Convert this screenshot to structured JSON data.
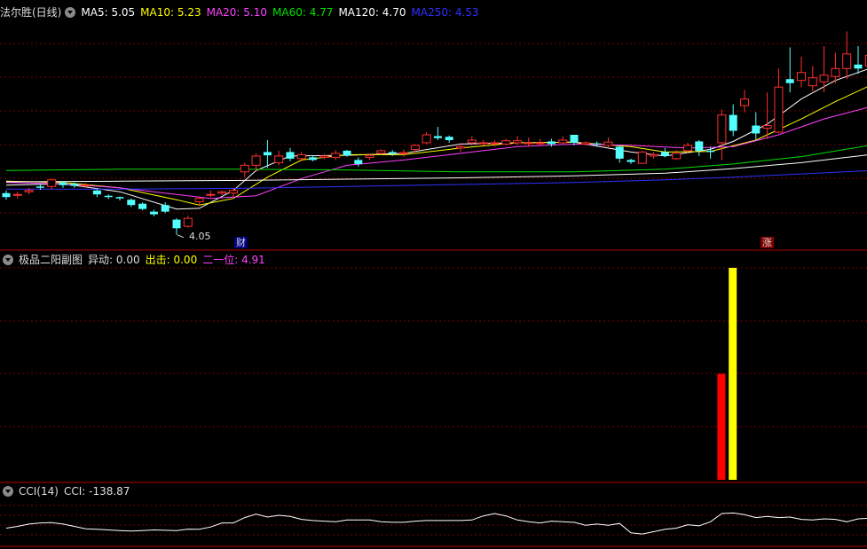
{
  "colors": {
    "ma5": "#ffffff",
    "ma10": "#ffff00",
    "ma20": "#ff40ff",
    "ma60": "#00e000",
    "ma120": "#ffffff",
    "ma250": "#3030ff",
    "up": "#ff3030",
    "down": "#54ffff",
    "grid": "#7a0000",
    "signal_red": "#ff0000",
    "signal_yellow": "#ffff00"
  },
  "main_panel": {
    "title": "法尔胜(日线)",
    "ma5": {
      "label": "MA5:",
      "value": "5.05"
    },
    "ma10": {
      "label": "MA10:",
      "value": "5.23"
    },
    "ma20": {
      "label": "MA20:",
      "value": "5.10"
    },
    "ma60": {
      "label": "MA60:",
      "value": "4.77"
    },
    "ma120": {
      "label": "MA120:",
      "value": "4.70"
    },
    "ma250": {
      "label": "MA250:",
      "value": "4.53"
    },
    "low_label": "4.05",
    "event_tag_1": "财",
    "event_tag_2": "涨"
  },
  "sub_panel": {
    "title": "极品二阳副图",
    "yidong": {
      "label": "异动:",
      "value": "0.00"
    },
    "chuji": {
      "label": "出击:",
      "value": "0.00"
    },
    "eryiwei": {
      "label": "二一位:",
      "value": "4.91"
    }
  },
  "cci_panel": {
    "title": "CCI(14)",
    "cci": {
      "label": "CCI:",
      "value": "-138.87"
    }
  },
  "chart_data": [
    {
      "type": "candlestick",
      "title": "法尔胜(日线)",
      "ylim": [
        3.9,
        7.3
      ],
      "candles": [
        [
          4.68,
          4.62,
          4.72,
          4.58
        ],
        [
          4.65,
          4.66,
          4.7,
          4.6
        ],
        [
          4.7,
          4.72,
          4.76,
          4.66
        ],
        [
          4.78,
          4.76,
          4.82,
          4.73
        ],
        [
          4.78,
          4.88,
          4.9,
          4.73
        ],
        [
          4.84,
          4.8,
          4.86,
          4.76
        ],
        [
          4.82,
          4.79,
          4.84,
          4.76
        ],
        [
          4.8,
          4.8,
          4.83,
          4.77
        ],
        [
          4.72,
          4.66,
          4.74,
          4.62
        ],
        [
          4.64,
          4.62,
          4.66,
          4.59
        ],
        [
          4.62,
          4.6,
          4.63,
          4.57
        ],
        [
          4.58,
          4.5,
          4.6,
          4.47
        ],
        [
          4.52,
          4.44,
          4.54,
          4.42
        ],
        [
          4.4,
          4.36,
          4.43,
          4.33
        ],
        [
          4.5,
          4.4,
          4.54,
          4.38
        ],
        [
          4.28,
          4.15,
          4.3,
          4.05
        ],
        [
          4.18,
          4.3,
          4.34,
          4.16
        ],
        [
          4.55,
          4.6,
          4.62,
          4.5
        ],
        [
          4.66,
          4.66,
          4.72,
          4.62
        ],
        [
          4.68,
          4.7,
          4.72,
          4.65
        ],
        [
          4.68,
          4.72,
          4.76,
          4.6
        ],
        [
          5.0,
          5.1,
          5.14,
          4.92
        ],
        [
          5.1,
          5.24,
          5.28,
          5.0
        ],
        [
          5.3,
          5.25,
          5.48,
          5.06
        ],
        [
          5.14,
          5.24,
          5.32,
          5.1
        ],
        [
          5.3,
          5.2,
          5.36,
          5.16
        ],
        [
          5.2,
          5.26,
          5.3,
          5.16
        ],
        [
          5.22,
          5.18,
          5.25,
          5.16
        ],
        [
          5.22,
          5.24,
          5.27,
          5.19
        ],
        [
          5.22,
          5.28,
          5.33,
          5.18
        ],
        [
          5.32,
          5.25,
          5.33,
          5.23
        ],
        [
          5.18,
          5.12,
          5.22,
          5.08
        ],
        [
          5.22,
          5.25,
          5.28,
          5.18
        ],
        [
          5.28,
          5.32,
          5.34,
          5.26
        ],
        [
          5.3,
          5.28,
          5.33,
          5.24
        ],
        [
          5.28,
          5.29,
          5.34,
          5.23
        ],
        [
          5.34,
          5.4,
          5.42,
          5.3
        ],
        [
          5.44,
          5.56,
          5.6,
          5.42
        ],
        [
          5.54,
          5.51,
          5.68,
          5.48
        ],
        [
          5.53,
          5.48,
          5.55,
          5.44
        ],
        [
          5.36,
          5.38,
          5.44,
          5.3
        ],
        [
          5.44,
          5.48,
          5.54,
          5.4
        ],
        [
          5.44,
          5.44,
          5.48,
          5.4
        ],
        [
          5.44,
          5.44,
          5.48,
          5.38
        ],
        [
          5.42,
          5.47,
          5.5,
          5.4
        ],
        [
          5.44,
          5.47,
          5.54,
          5.4
        ],
        [
          5.44,
          5.44,
          5.52,
          5.38
        ],
        [
          5.44,
          5.44,
          5.5,
          5.4
        ],
        [
          5.46,
          5.42,
          5.5,
          5.38
        ],
        [
          5.44,
          5.48,
          5.54,
          5.42
        ],
        [
          5.56,
          5.44,
          5.56,
          5.4
        ],
        [
          5.42,
          5.44,
          5.46,
          5.4
        ],
        [
          5.43,
          5.42,
          5.46,
          5.38
        ],
        [
          5.4,
          5.45,
          5.52,
          5.36
        ],
        [
          5.38,
          5.2,
          5.4,
          5.14
        ],
        [
          5.18,
          5.15,
          5.2,
          5.12
        ],
        [
          5.13,
          5.3,
          5.32,
          5.12
        ],
        [
          5.24,
          5.26,
          5.3,
          5.2
        ],
        [
          5.3,
          5.24,
          5.36,
          5.22
        ],
        [
          5.2,
          5.28,
          5.33,
          5.18
        ],
        [
          5.32,
          5.4,
          5.44,
          5.28
        ],
        [
          5.46,
          5.32,
          5.48,
          5.24
        ],
        [
          5.32,
          5.3,
          5.38,
          5.2
        ],
        [
          5.44,
          5.86,
          5.94,
          5.18
        ],
        [
          5.86,
          5.62,
          6.02,
          5.54
        ],
        [
          6.0,
          6.1,
          6.24,
          5.9
        ],
        [
          5.7,
          5.58,
          5.9,
          5.48
        ],
        [
          5.66,
          5.7,
          6.2,
          5.5
        ],
        [
          5.6,
          6.28,
          6.56,
          5.58
        ],
        [
          6.4,
          6.34,
          6.88,
          6.2
        ],
        [
          6.38,
          6.5,
          6.74,
          6.28
        ],
        [
          6.3,
          6.42,
          6.6,
          6.22
        ],
        [
          6.36,
          6.46,
          6.9,
          6.2
        ],
        [
          6.44,
          6.56,
          6.8,
          6.34
        ],
        [
          6.56,
          6.78,
          7.12,
          6.4
        ],
        [
          6.62,
          6.56,
          6.9,
          6.48
        ],
        [
          6.6,
          6.76,
          7.1,
          6.44
        ]
      ],
      "ma_series": [
        {
          "name": "MA5",
          "points": [
            [
              0,
              4.8
            ],
            [
              5,
              4.82
            ],
            [
              10,
              4.7
            ],
            [
              15,
              4.44
            ],
            [
              17,
              4.45
            ],
            [
              20,
              4.72
            ],
            [
              22,
              5.02
            ],
            [
              25,
              5.24
            ],
            [
              30,
              5.25
            ],
            [
              35,
              5.28
            ],
            [
              40,
              5.42
            ],
            [
              45,
              5.44
            ],
            [
              50,
              5.45
            ],
            [
              55,
              5.3
            ],
            [
              58,
              5.24
            ],
            [
              62,
              5.34
            ],
            [
              64,
              5.46
            ],
            [
              67,
              5.72
            ],
            [
              70,
              6.1
            ],
            [
              73,
              6.38
            ],
            [
              76,
              6.56
            ]
          ]
        },
        {
          "name": "MA10",
          "points": [
            [
              0,
              4.86
            ],
            [
              5,
              4.84
            ],
            [
              10,
              4.76
            ],
            [
              15,
              4.58
            ],
            [
              17,
              4.5
            ],
            [
              20,
              4.6
            ],
            [
              23,
              4.92
            ],
            [
              26,
              5.18
            ],
            [
              30,
              5.26
            ],
            [
              35,
              5.26
            ],
            [
              40,
              5.36
            ],
            [
              45,
              5.44
            ],
            [
              50,
              5.45
            ],
            [
              55,
              5.38
            ],
            [
              58,
              5.3
            ],
            [
              62,
              5.31
            ],
            [
              66,
              5.48
            ],
            [
              70,
              5.8
            ],
            [
              73,
              6.06
            ],
            [
              76,
              6.3
            ]
          ]
        },
        {
          "name": "MA20",
          "points": [
            [
              0,
              4.84
            ],
            [
              5,
              4.82
            ],
            [
              10,
              4.76
            ],
            [
              14,
              4.68
            ],
            [
              18,
              4.6
            ],
            [
              22,
              4.64
            ],
            [
              26,
              4.9
            ],
            [
              30,
              5.1
            ],
            [
              35,
              5.18
            ],
            [
              40,
              5.28
            ],
            [
              45,
              5.38
            ],
            [
              50,
              5.42
            ],
            [
              55,
              5.4
            ],
            [
              60,
              5.36
            ],
            [
              64,
              5.38
            ],
            [
              68,
              5.56
            ],
            [
              72,
              5.8
            ],
            [
              76,
              5.98
            ]
          ]
        },
        {
          "name": "MA60",
          "points": [
            [
              0,
              5.02
            ],
            [
              10,
              5.04
            ],
            [
              20,
              5.04
            ],
            [
              30,
              5.03
            ],
            [
              40,
              5.0
            ],
            [
              50,
              5.0
            ],
            [
              58,
              5.04
            ],
            [
              64,
              5.12
            ],
            [
              70,
              5.23
            ],
            [
              76,
              5.4
            ]
          ]
        },
        {
          "name": "MA120",
          "points": [
            [
              0,
              4.85
            ],
            [
              10,
              4.86
            ],
            [
              20,
              4.87
            ],
            [
              30,
              4.89
            ],
            [
              40,
              4.91
            ],
            [
              50,
              4.94
            ],
            [
              58,
              4.98
            ],
            [
              64,
              5.05
            ],
            [
              70,
              5.14
            ],
            [
              76,
              5.26
            ]
          ]
        },
        {
          "name": "MA250",
          "points": [
            [
              0,
              4.74
            ],
            [
              10,
              4.74
            ],
            [
              20,
              4.75
            ],
            [
              30,
              4.78
            ],
            [
              40,
              4.81
            ],
            [
              50,
              4.84
            ],
            [
              58,
              4.88
            ],
            [
              64,
              4.92
            ],
            [
              70,
              4.97
            ],
            [
              76,
              5.02
            ]
          ]
        }
      ]
    },
    {
      "type": "bar",
      "title": "极品二阳副图",
      "series": [
        {
          "name": "异动",
          "index": 63,
          "value": 0.5
        },
        {
          "name": "二一位",
          "index": 64,
          "value": 1.0
        }
      ],
      "ylim": [
        0,
        1.0
      ]
    },
    {
      "type": "line",
      "title": "CCI(14)",
      "ylim": [
        -250,
        250
      ],
      "values": [
        -110,
        -95,
        -75,
        -65,
        -62,
        -75,
        -95,
        -115,
        -120,
        -125,
        -130,
        -135,
        -130,
        -125,
        -128,
        -130,
        -118,
        -120,
        -100,
        -65,
        -65,
        -20,
        10,
        -15,
        0,
        -10,
        -35,
        -45,
        -50,
        -55,
        -40,
        -40,
        -40,
        -55,
        -60,
        -60,
        -50,
        -45,
        -45,
        -45,
        -45,
        -40,
        -5,
        15,
        -5,
        -40,
        -55,
        -65,
        -50,
        -55,
        -60,
        -85,
        -75,
        -85,
        -70,
        -150,
        -160,
        -140,
        -120,
        -110,
        -80,
        -90,
        -55,
        15,
        20,
        5,
        -20,
        -10,
        -20,
        -15,
        -35,
        -40,
        -30,
        -35,
        -55,
        -30,
        -25
      ]
    }
  ]
}
